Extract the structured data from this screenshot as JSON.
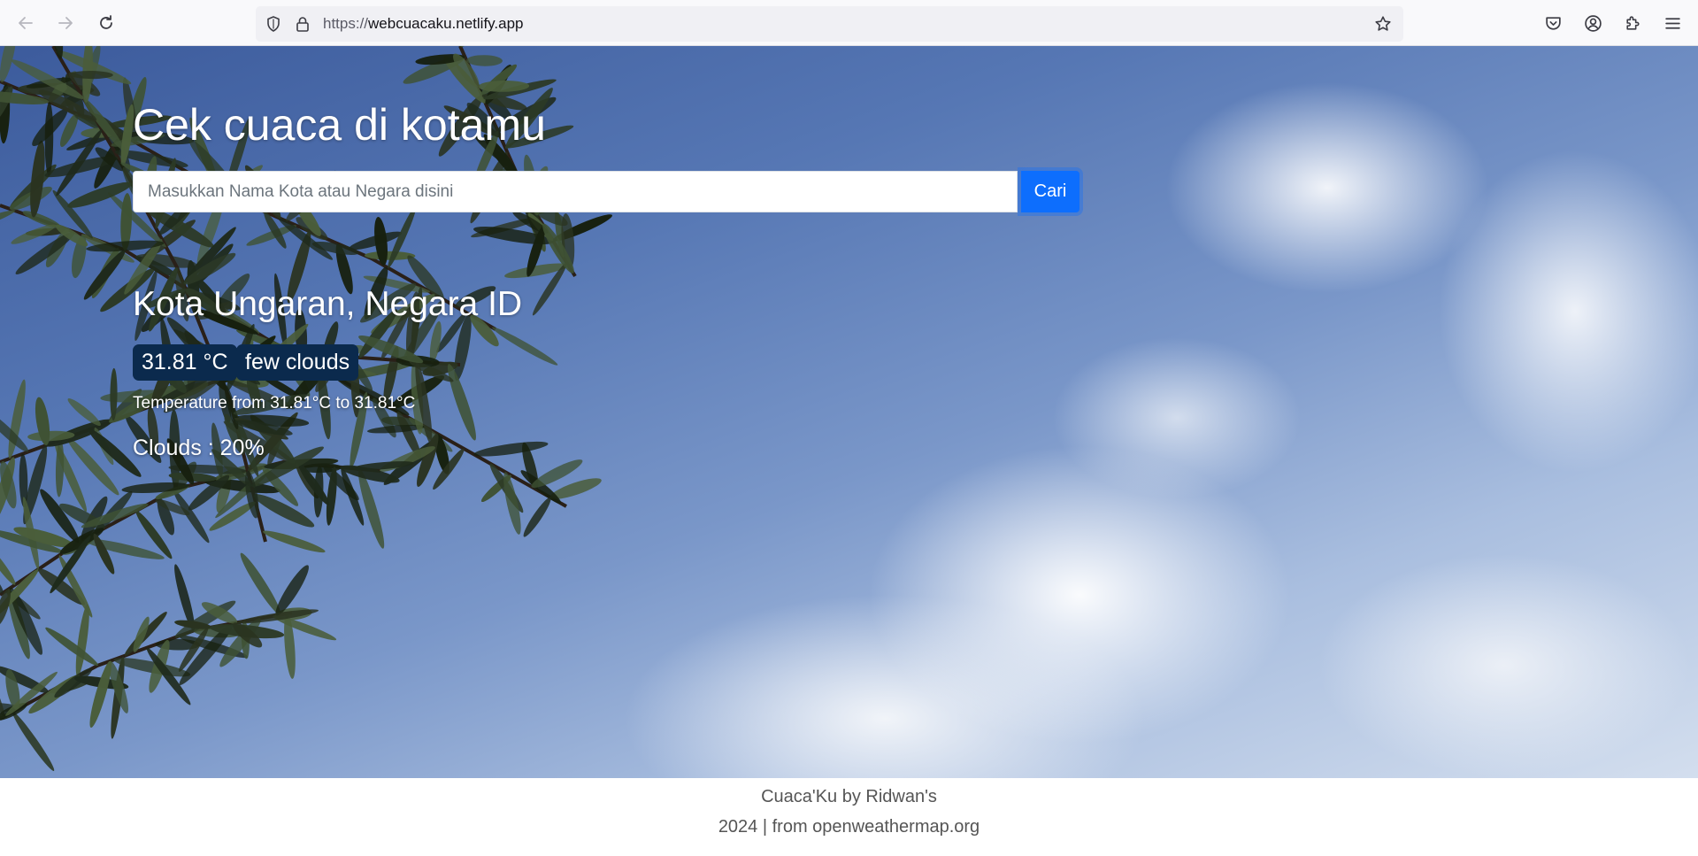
{
  "browser": {
    "url_scheme": "https://",
    "url_host": "webcuacaku.netlify.app",
    "icons": {
      "back": "arrow-left-icon",
      "forward": "arrow-right-icon",
      "reload": "reload-icon",
      "tracking": "shield-icon",
      "secure": "lock-icon",
      "bookmark": "star-icon",
      "pocket": "pocket-icon",
      "account": "account-icon",
      "extensions": "puzzle-icon",
      "menu": "hamburger-menu-icon"
    }
  },
  "page": {
    "headline": "Cek cuaca di kotamu",
    "search": {
      "placeholder": "Masukkan Nama Kota atau Negara disini",
      "value": "",
      "button_label": "Cari"
    },
    "weather": {
      "location": "Kota Ungaran, Negara ID",
      "temperature": "31.81 °C",
      "description": "few clouds",
      "temperature_range": "Temperature from 31.81°C to 31.81°C",
      "clouds": "Clouds : 20%"
    }
  },
  "footer": {
    "line1": "Cuaca'Ku by Ridwan's",
    "line2": "2024 | from openweathermap.org"
  },
  "colors": {
    "accent": "#0d6efd",
    "badge_bg": "#0b2a4d",
    "text_on_image": "#ffffff",
    "footer_text": "#555555"
  }
}
